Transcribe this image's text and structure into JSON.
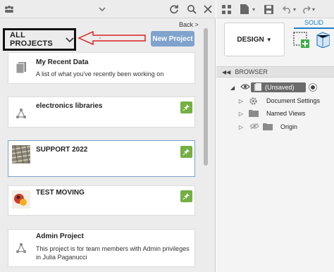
{
  "left_panel": {
    "back_label": "Back >",
    "projects_dropdown_label": "ALL PROJECTS",
    "new_project_label": "New Project",
    "projects": [
      {
        "title": "My Recent Data",
        "description": "A list of what you've recently been working on",
        "pinned": false
      },
      {
        "title": "electronics libraries",
        "description": "",
        "pinned": true
      },
      {
        "title": "SUPPORT 2022",
        "description": "",
        "pinned": true
      },
      {
        "title": "TEST MOVING",
        "description": "",
        "pinned": true
      },
      {
        "title": "Admin Project",
        "description": "This project is for team members with Admin privileges in Julia Paganucci",
        "pinned": false
      }
    ]
  },
  "right_panel": {
    "workspace_label": "DESIGN",
    "solid_tab_label": "SOLID",
    "browser_label": "BROWSER",
    "tree": [
      {
        "label": "(Unsaved)"
      },
      {
        "label": "Document Settings"
      },
      {
        "label": "Named Views"
      },
      {
        "label": "Origin"
      }
    ]
  },
  "colors": {
    "accent_blue": "#7fa3cc",
    "pin_green": "#74b042",
    "annotation_red": "#e02020"
  }
}
